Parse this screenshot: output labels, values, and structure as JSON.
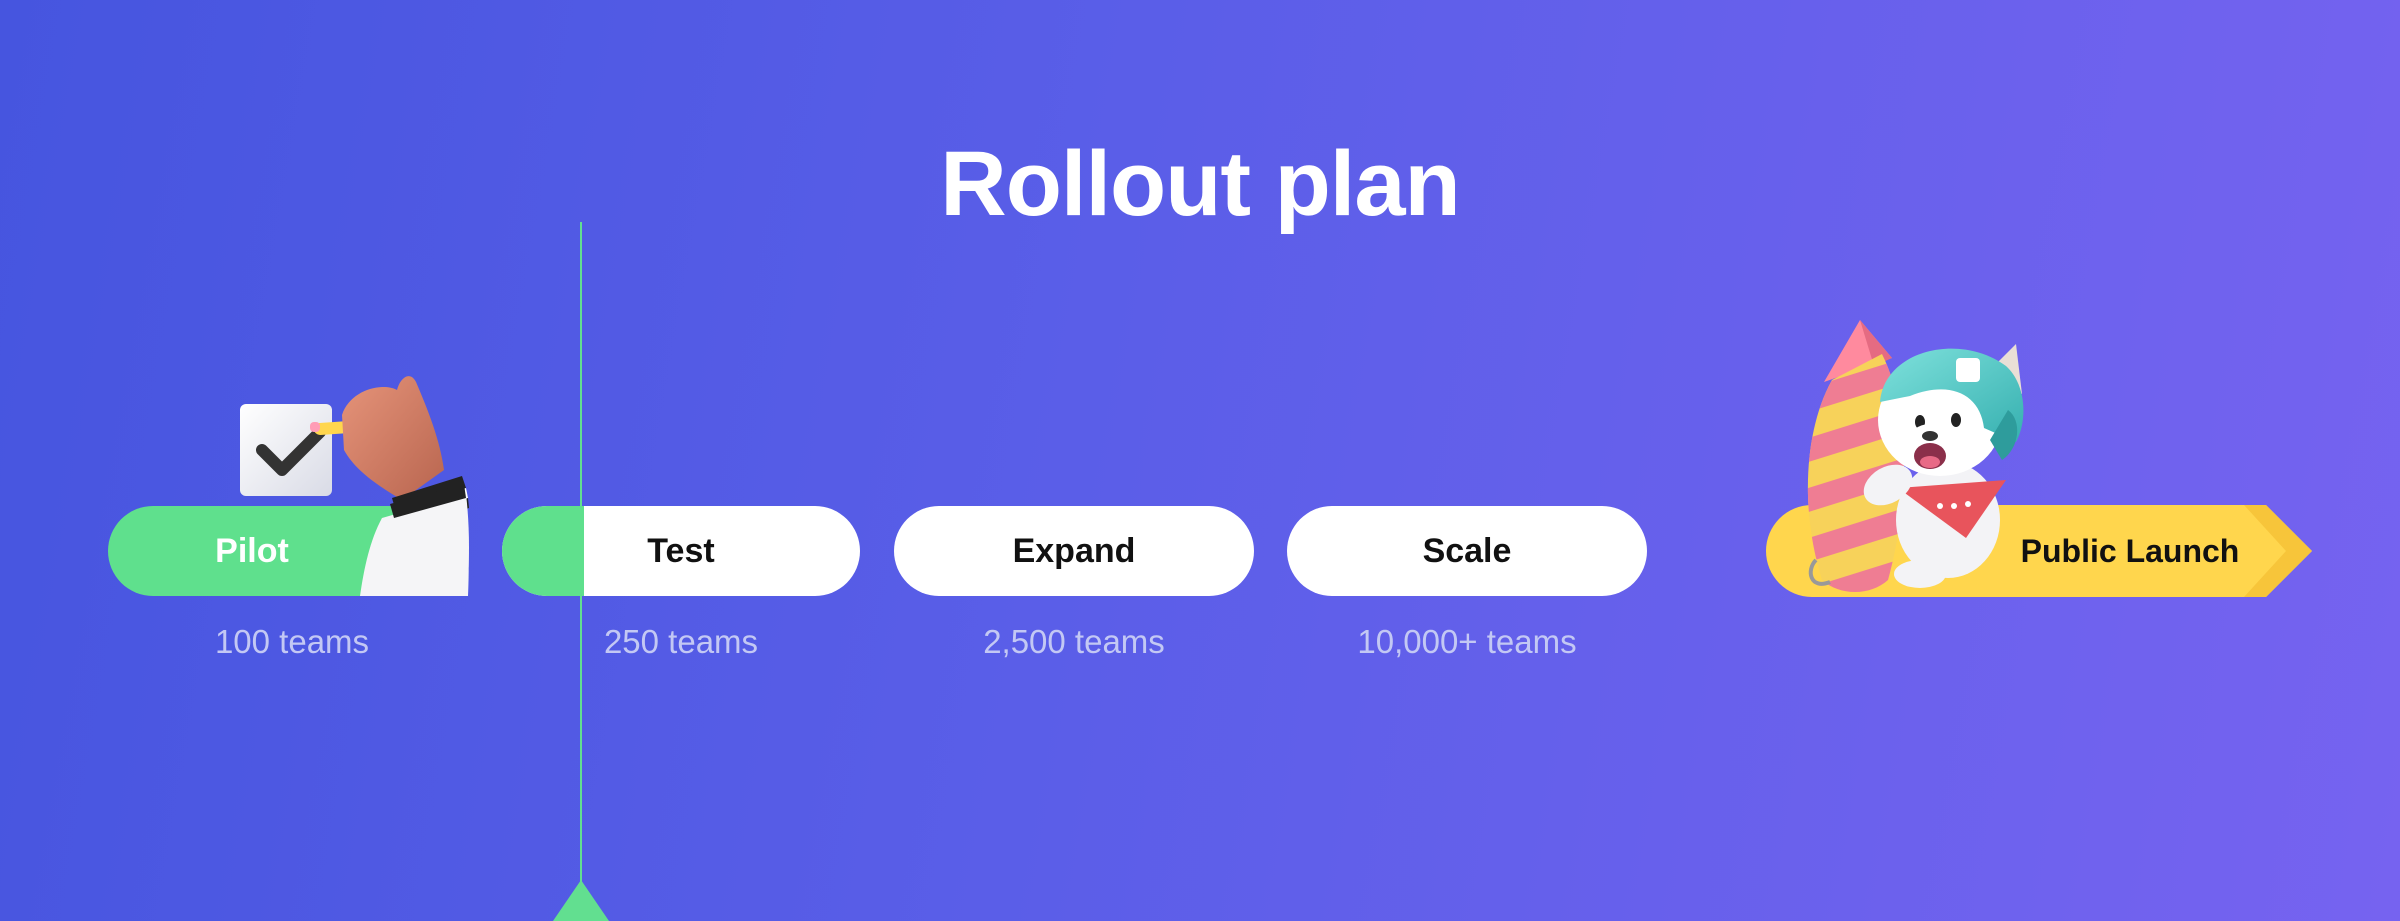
{
  "title": "Rollout plan",
  "stages": [
    {
      "label": "Pilot",
      "teams": "100 teams",
      "status": "complete",
      "progress": 1.0
    },
    {
      "label": "Test",
      "teams": "250 teams",
      "status": "in-progress",
      "progress": 0.23
    },
    {
      "label": "Expand",
      "teams": "2,500 teams",
      "status": "upcoming",
      "progress": 0
    },
    {
      "label": "Scale",
      "teams": "10,000+ teams",
      "status": "upcoming",
      "progress": 0
    }
  ],
  "final_stage": {
    "label": "Public Launch"
  },
  "colors": {
    "complete": "#5fe08d",
    "upcoming": "#ffffff",
    "launch": "#ffd64d",
    "marker": "#62df90"
  },
  "icons": {
    "pilot": "hand-checkbox-icon",
    "launch": "dog-rocket-icon"
  }
}
